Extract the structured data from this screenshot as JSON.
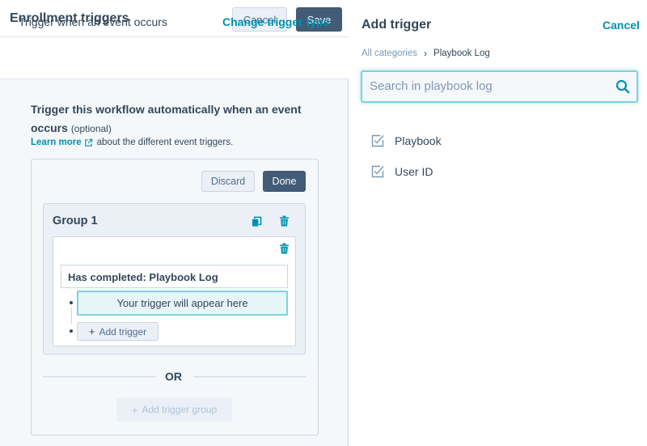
{
  "left": {
    "title": "Enrollment triggers",
    "cancel_label": "Cancel",
    "save_label": "Save",
    "trigger_row_label": "Trigger when an event occurs",
    "change_trigger_label": "Change trigger type",
    "description_title": "Trigger this workflow automatically when an event occurs",
    "description_optional": "(optional)",
    "learn_more_label": "Learn more",
    "learn_more_suffix": "about the different event triggers.",
    "discard_label": "Discard",
    "done_label": "Done",
    "group": {
      "title": "Group 1",
      "condition": "Has completed: Playbook Log",
      "placeholder": "Your trigger will appear here",
      "add_trigger_label": "Add trigger"
    },
    "or_label": "OR",
    "add_group_label": "Add trigger group"
  },
  "right": {
    "title": "Add trigger",
    "cancel_label": "Cancel",
    "breadcrumb": {
      "all": "All categories",
      "separator": "›",
      "current": "Playbook Log"
    },
    "search": {
      "placeholder": "Search in playbook log",
      "value": ""
    },
    "properties": [
      {
        "label": "Playbook",
        "icon": "property-check-icon"
      },
      {
        "label": "User ID",
        "icon": "property-check-icon"
      }
    ]
  },
  "colors": {
    "accent": "#0091ae",
    "primary_button": "#425b76",
    "text": "#33475b",
    "highlight_border": "#7fd1de"
  }
}
